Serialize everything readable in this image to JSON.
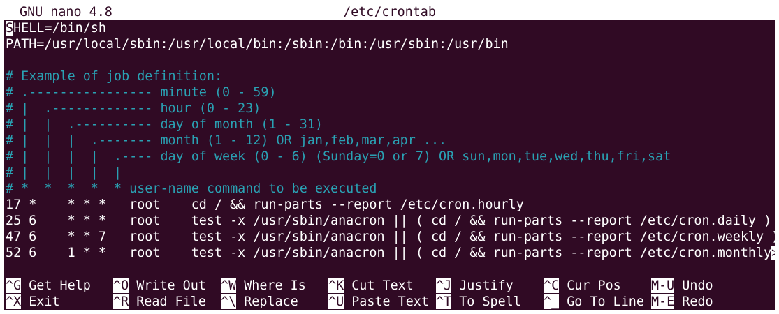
{
  "window": {
    "app_name": "GNU nano 4.8",
    "file_name": "/etc/crontab"
  },
  "editor": {
    "lines": [
      {
        "cursor_char": "S",
        "text": "HELL=/bin/sh",
        "style": "normal"
      },
      {
        "cursor_char": "",
        "text": "PATH=/usr/local/sbin:/usr/local/bin:/sbin:/bin:/usr/sbin:/usr/bin",
        "style": "normal"
      },
      {
        "cursor_char": "",
        "text": "",
        "style": "normal"
      },
      {
        "cursor_char": "",
        "text": "# Example of job definition:",
        "style": "comment"
      },
      {
        "cursor_char": "",
        "text": "# .---------------- minute (0 - 59)",
        "style": "comment"
      },
      {
        "cursor_char": "",
        "text": "# |  .------------- hour (0 - 23)",
        "style": "comment"
      },
      {
        "cursor_char": "",
        "text": "# |  |  .---------- day of month (1 - 31)",
        "style": "comment"
      },
      {
        "cursor_char": "",
        "text": "# |  |  |  .------- month (1 - 12) OR jan,feb,mar,apr ...",
        "style": "comment"
      },
      {
        "cursor_char": "",
        "text": "# |  |  |  |  .---- day of week (0 - 6) (Sunday=0 or 7) OR sun,mon,tue,wed,thu,fri,sat",
        "style": "comment"
      },
      {
        "cursor_char": "",
        "text": "# |  |  |  |  |",
        "style": "comment"
      },
      {
        "cursor_char": "",
        "text": "# *  *  *  *  * user-name command to be executed",
        "style": "comment"
      },
      {
        "cursor_char": "",
        "text": "17 *    * * *   root    cd / && run-parts --report /etc/cron.hourly",
        "style": "normal"
      },
      {
        "cursor_char": "",
        "text": "25 6    * * *   root    test -x /usr/sbin/anacron || ( cd / && run-parts --report /etc/cron.daily )",
        "style": "normal"
      },
      {
        "cursor_char": "",
        "text": "47 6    * * 7   root    test -x /usr/sbin/anacron || ( cd / && run-parts --report /etc/cron.weekly )",
        "style": "normal"
      },
      {
        "cursor_char": "",
        "text": "52 6    1 * *   root    test -x /usr/sbin/anacron || ( cd / && run-parts --report /etc/cron.monthly",
        "style": "normal",
        "overflow_marker": ">"
      }
    ]
  },
  "shortcuts": {
    "row1": [
      {
        "key": "^G",
        "label": "Get Help"
      },
      {
        "key": "^O",
        "label": "Write Out"
      },
      {
        "key": "^W",
        "label": "Where Is"
      },
      {
        "key": "^K",
        "label": "Cut Text"
      },
      {
        "key": "^J",
        "label": "Justify"
      },
      {
        "key": "^C",
        "label": "Cur Pos"
      },
      {
        "key": "M-U",
        "label": "Undo"
      }
    ],
    "row2": [
      {
        "key": "^X",
        "label": "Exit"
      },
      {
        "key": "^R",
        "label": "Read File"
      },
      {
        "key": "^\\",
        "label": "Replace"
      },
      {
        "key": "^U",
        "label": "Paste Text"
      },
      {
        "key": "^T",
        "label": "To Spell"
      },
      {
        "key": "^_",
        "label": "Go To Line"
      },
      {
        "key": "M-E",
        "label": "Redo"
      }
    ]
  },
  "colors": {
    "terminal_background": "#300a24",
    "foreground": "#ffffff",
    "comment": "#2aa1b3"
  }
}
